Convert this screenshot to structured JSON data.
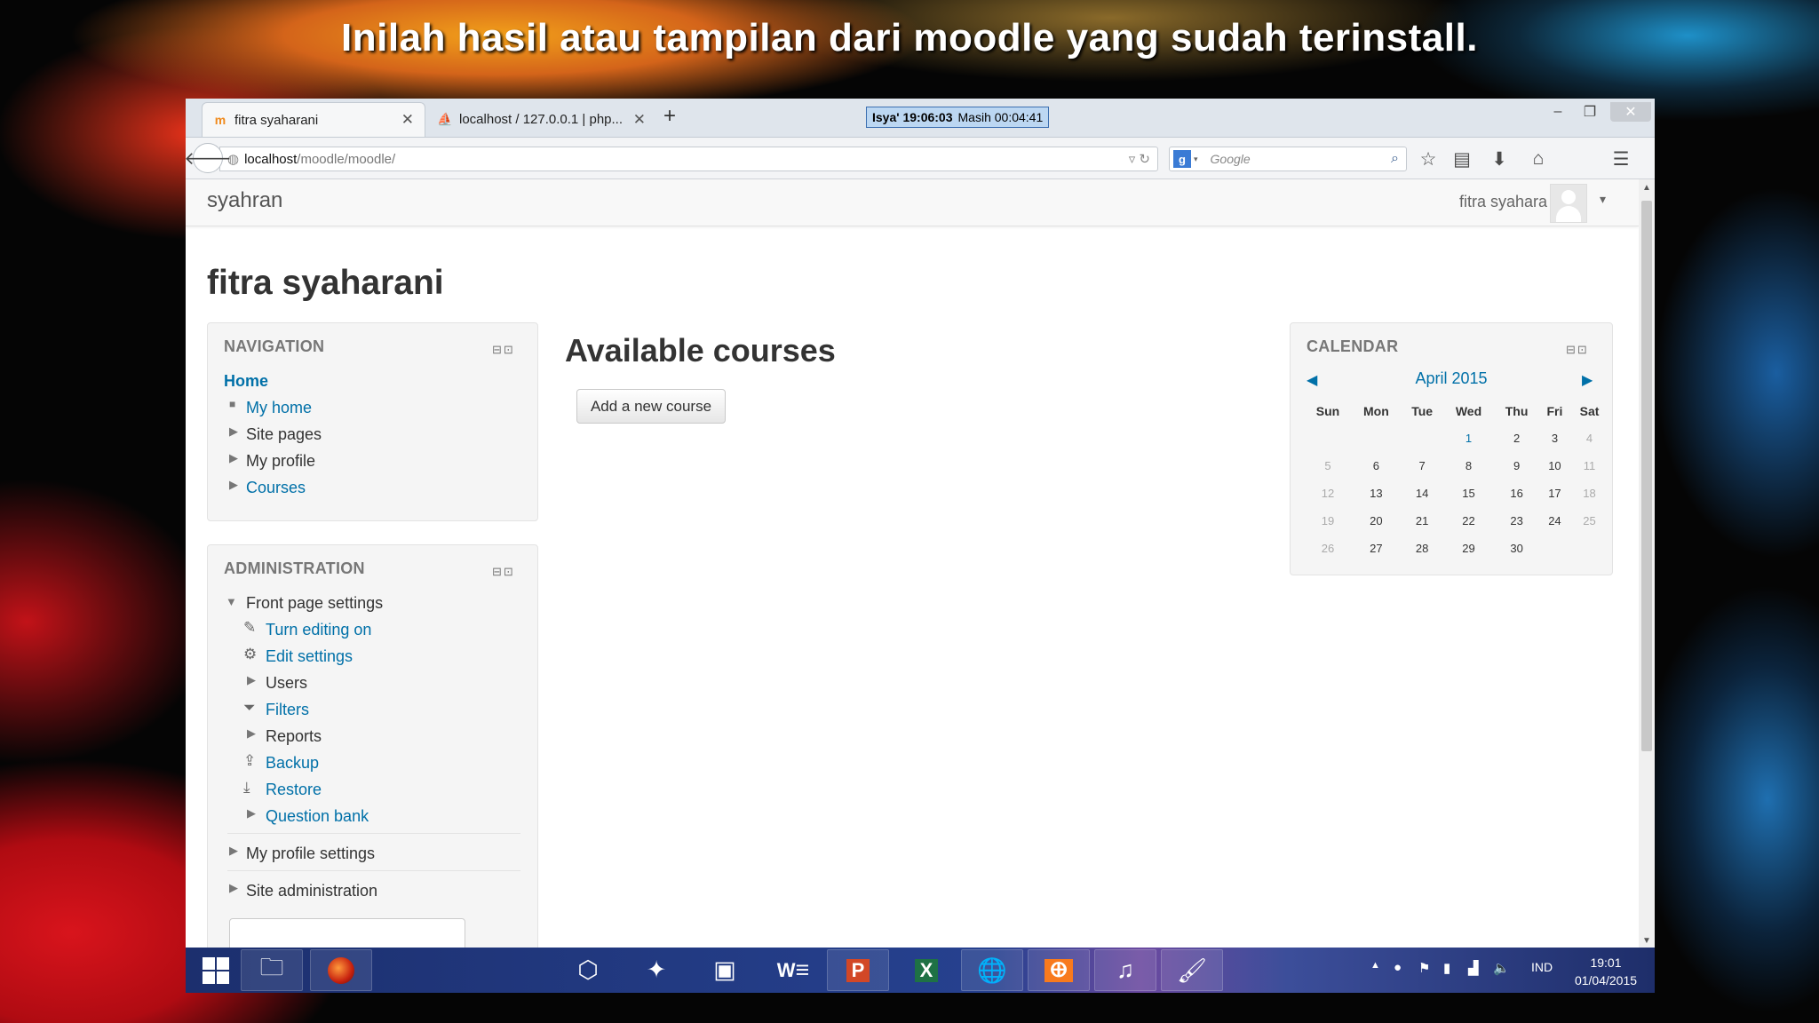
{
  "slide": {
    "caption": "Inilah hasil atau tampilan dari moodle yang sudah terinstall."
  },
  "browser": {
    "tabs": [
      {
        "label": "fitra syaharani",
        "active": true
      },
      {
        "label": "localhost / 127.0.0.1 | php...",
        "active": false
      }
    ],
    "prayer_clock": {
      "time_label": "Isya' 19:06:03",
      "remaining_label": "Masih 00:04:41"
    },
    "url": {
      "host": "localhost",
      "path": "/moodle/moodle/"
    },
    "search_placeholder": "Google",
    "search_engine_letter": "g"
  },
  "moodle": {
    "brand": "syahran",
    "user_name": "fitra syahara",
    "page_title": "fitra syaharani",
    "main_heading": "Available courses",
    "add_course_button": "Add a new course",
    "navigation": {
      "title": "NAVIGATION",
      "home": "Home",
      "items": [
        {
          "label": "My home",
          "link": true
        },
        {
          "label": "Site pages",
          "link": false
        },
        {
          "label": "My profile",
          "link": false
        },
        {
          "label": "Courses",
          "link": true
        }
      ]
    },
    "administration": {
      "title": "ADMINISTRATION",
      "front_page_settings": "Front page settings",
      "items": [
        {
          "label": "Turn editing on",
          "icon": "pencil-icon"
        },
        {
          "label": "Edit settings",
          "icon": "gear-icon"
        },
        {
          "label": "Users",
          "icon": "expand-arrow-icon"
        },
        {
          "label": "Filters",
          "icon": "funnel-icon"
        },
        {
          "label": "Reports",
          "icon": "expand-arrow-icon"
        },
        {
          "label": "Backup",
          "icon": "upload-icon"
        },
        {
          "label": "Restore",
          "icon": "download-icon"
        },
        {
          "label": "Question bank",
          "icon": "expand-arrow-icon"
        }
      ],
      "my_profile_settings": "My profile settings",
      "site_administration": "Site administration"
    },
    "calendar": {
      "title": "CALENDAR",
      "month": "April 2015",
      "weekdays": [
        "Sun",
        "Mon",
        "Tue",
        "Wed",
        "Thu",
        "Fri",
        "Sat"
      ],
      "weeks": [
        [
          "",
          "",
          "",
          "1",
          "2",
          "3",
          "4"
        ],
        [
          "5",
          "6",
          "7",
          "8",
          "9",
          "10",
          "11"
        ],
        [
          "12",
          "13",
          "14",
          "15",
          "16",
          "17",
          "18"
        ],
        [
          "19",
          "20",
          "21",
          "22",
          "23",
          "24",
          "25"
        ],
        [
          "26",
          "27",
          "28",
          "29",
          "30",
          "",
          ""
        ]
      ],
      "today": "1"
    }
  },
  "taskbar": {
    "language": "IND",
    "time": "19:01",
    "date": "01/04/2015"
  },
  "colors": {
    "link": "#0070a8",
    "taskbar": "#26418f",
    "prayer_box": "#bcd7f2"
  }
}
